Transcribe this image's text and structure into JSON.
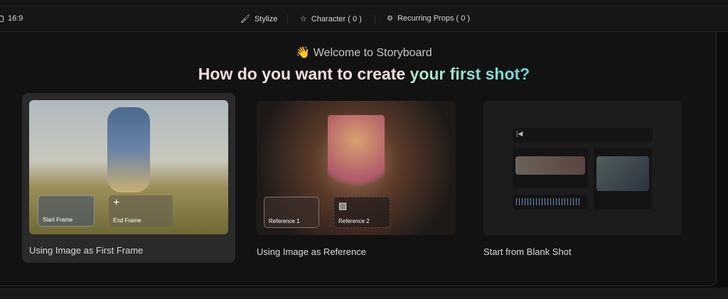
{
  "toolbar": {
    "aspect": "16:9",
    "stylize": "Stylize",
    "character": "Character ( 0 )",
    "props": "Recurring Props ( 0 )"
  },
  "welcome": {
    "emoji": "👋",
    "text": "Welcome to Storyboard"
  },
  "heading": {
    "part1": "How do you want to create ",
    "part2": "your first shot?"
  },
  "cards": [
    {
      "label": "Using Image as First Frame",
      "start": "Start Frame",
      "end": "End Frame"
    },
    {
      "label": "Using Image as Reference",
      "ref1": "Reference 1",
      "ref2": "Reference 2"
    },
    {
      "label": "Start from Blank Shot"
    }
  ]
}
